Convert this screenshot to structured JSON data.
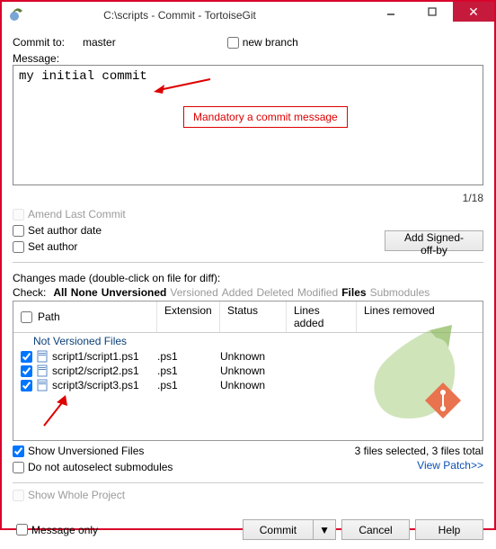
{
  "window": {
    "title": "C:\\scripts - Commit - TortoiseGit"
  },
  "commit_to": {
    "label": "Commit to:",
    "value": "master"
  },
  "new_branch": {
    "label": "new branch"
  },
  "message": {
    "label": "Message:",
    "value": "my initial commit",
    "counter": "1/18",
    "callout": "Mandatory a commit message"
  },
  "amend": {
    "label": "Amend Last Commit"
  },
  "set_author_date": {
    "label": "Set author date"
  },
  "set_author": {
    "label": "Set author"
  },
  "add_signed_off": {
    "label": "Add Signed-off-by"
  },
  "changes_label": "Changes made (double-click on file for diff):",
  "check": {
    "label": "Check:",
    "all": "All",
    "none": "None",
    "unversioned": "Unversioned",
    "versioned": "Versioned",
    "added": "Added",
    "deleted": "Deleted",
    "modified": "Modified",
    "files": "Files",
    "submodules": "Submodules"
  },
  "columns": {
    "path": "Path",
    "extension": "Extension",
    "status": "Status",
    "lines_added": "Lines added",
    "lines_removed": "Lines removed"
  },
  "group": "Not Versioned Files",
  "files": [
    {
      "path": "script1/script1.ps1",
      "ext": ".ps1",
      "status": "Unknown"
    },
    {
      "path": "script2/script2.ps1",
      "ext": ".ps1",
      "status": "Unknown"
    },
    {
      "path": "script3/script3.ps1",
      "ext": ".ps1",
      "status": "Unknown"
    }
  ],
  "show_unversioned": {
    "label": "Show Unversioned Files"
  },
  "no_autoselect": {
    "label": "Do not autoselect submodules"
  },
  "stats": "3 files selected, 3 files total",
  "view_patch": "View Patch>>",
  "show_whole_project": {
    "label": "Show Whole Project"
  },
  "message_only": {
    "label": "Message only"
  },
  "buttons": {
    "commit": "Commit",
    "cancel": "Cancel",
    "help": "Help"
  }
}
